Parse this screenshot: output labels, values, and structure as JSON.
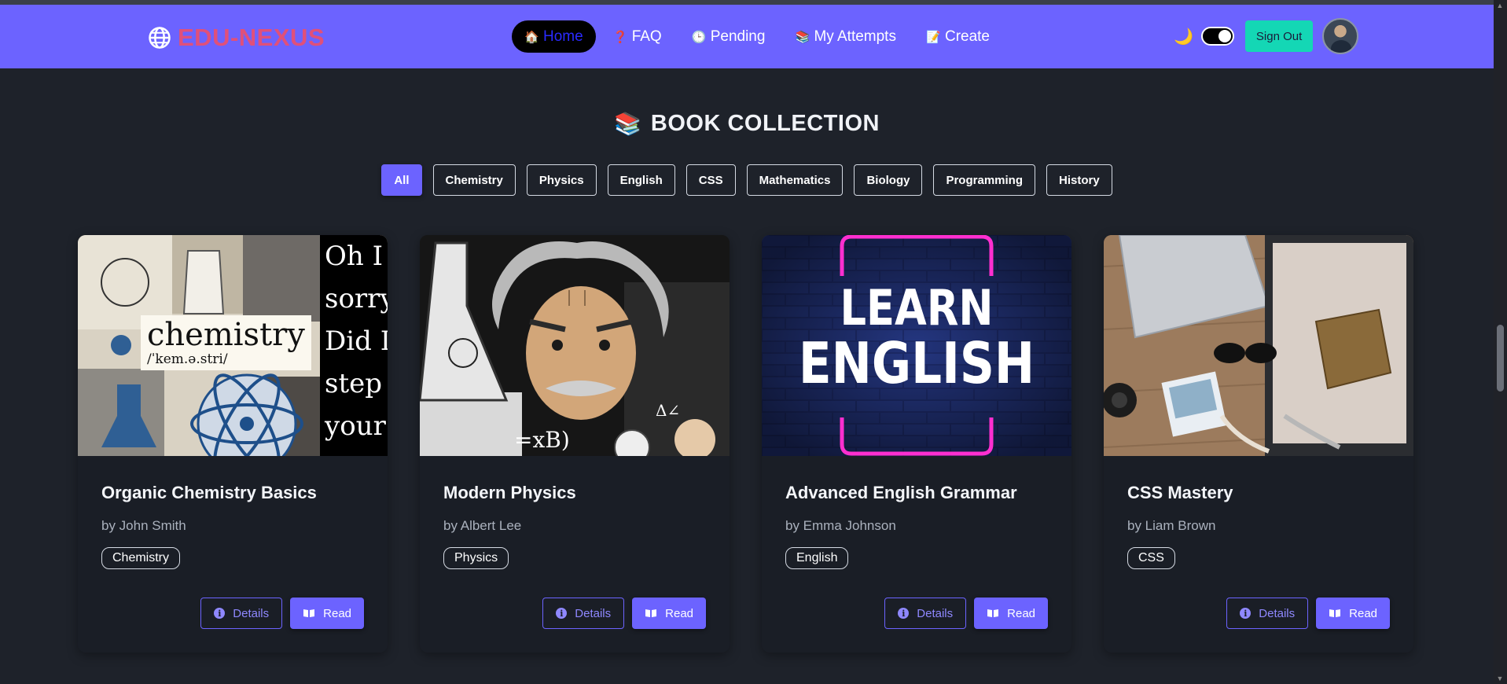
{
  "navbar": {
    "brand": "EDU-NEXUS",
    "links": [
      {
        "label": "Home",
        "icon": "🏠",
        "active": true
      },
      {
        "label": "FAQ",
        "icon": "❓",
        "active": false
      },
      {
        "label": "Pending",
        "icon": "🕒",
        "active": false
      },
      {
        "label": "My Attempts",
        "icon": "📚",
        "active": false
      },
      {
        "label": "Create",
        "icon": "📝",
        "active": false
      }
    ],
    "theme_icon": "🌙",
    "sign_out": "Sign Out"
  },
  "section": {
    "icon": "📚",
    "title": "BOOK COLLECTION"
  },
  "filters": [
    "All",
    "Chemistry",
    "Physics",
    "English",
    "CSS",
    "Mathematics",
    "Biology",
    "Programming",
    "History"
  ],
  "active_filter": "All",
  "books": [
    {
      "title": "Organic Chemistry Basics",
      "author": "by John Smith",
      "tag": "Chemistry",
      "cover": {
        "word": "chemistry",
        "phonetic": "/ˈkem.ə.stri/",
        "side_text": "Oh I h\nsorry -\nDid I\nstep on\nyour\nmomen"
      }
    },
    {
      "title": "Modern Physics",
      "author": "by Albert Lee",
      "tag": "Physics",
      "cover": {}
    },
    {
      "title": "Advanced English Grammar",
      "author": "by Emma Johnson",
      "tag": "English",
      "cover": {
        "line1": "LEARN",
        "line2": "ENGLISH"
      }
    },
    {
      "title": "CSS Mastery",
      "author": "by Liam Brown",
      "tag": "CSS",
      "cover": {}
    }
  ],
  "actions": {
    "details": "Details",
    "read": "Read"
  },
  "colors": {
    "accent": "#6c63ff",
    "brand": "#e0507a",
    "signout": "#14d7b5",
    "background": "#1e222a"
  }
}
